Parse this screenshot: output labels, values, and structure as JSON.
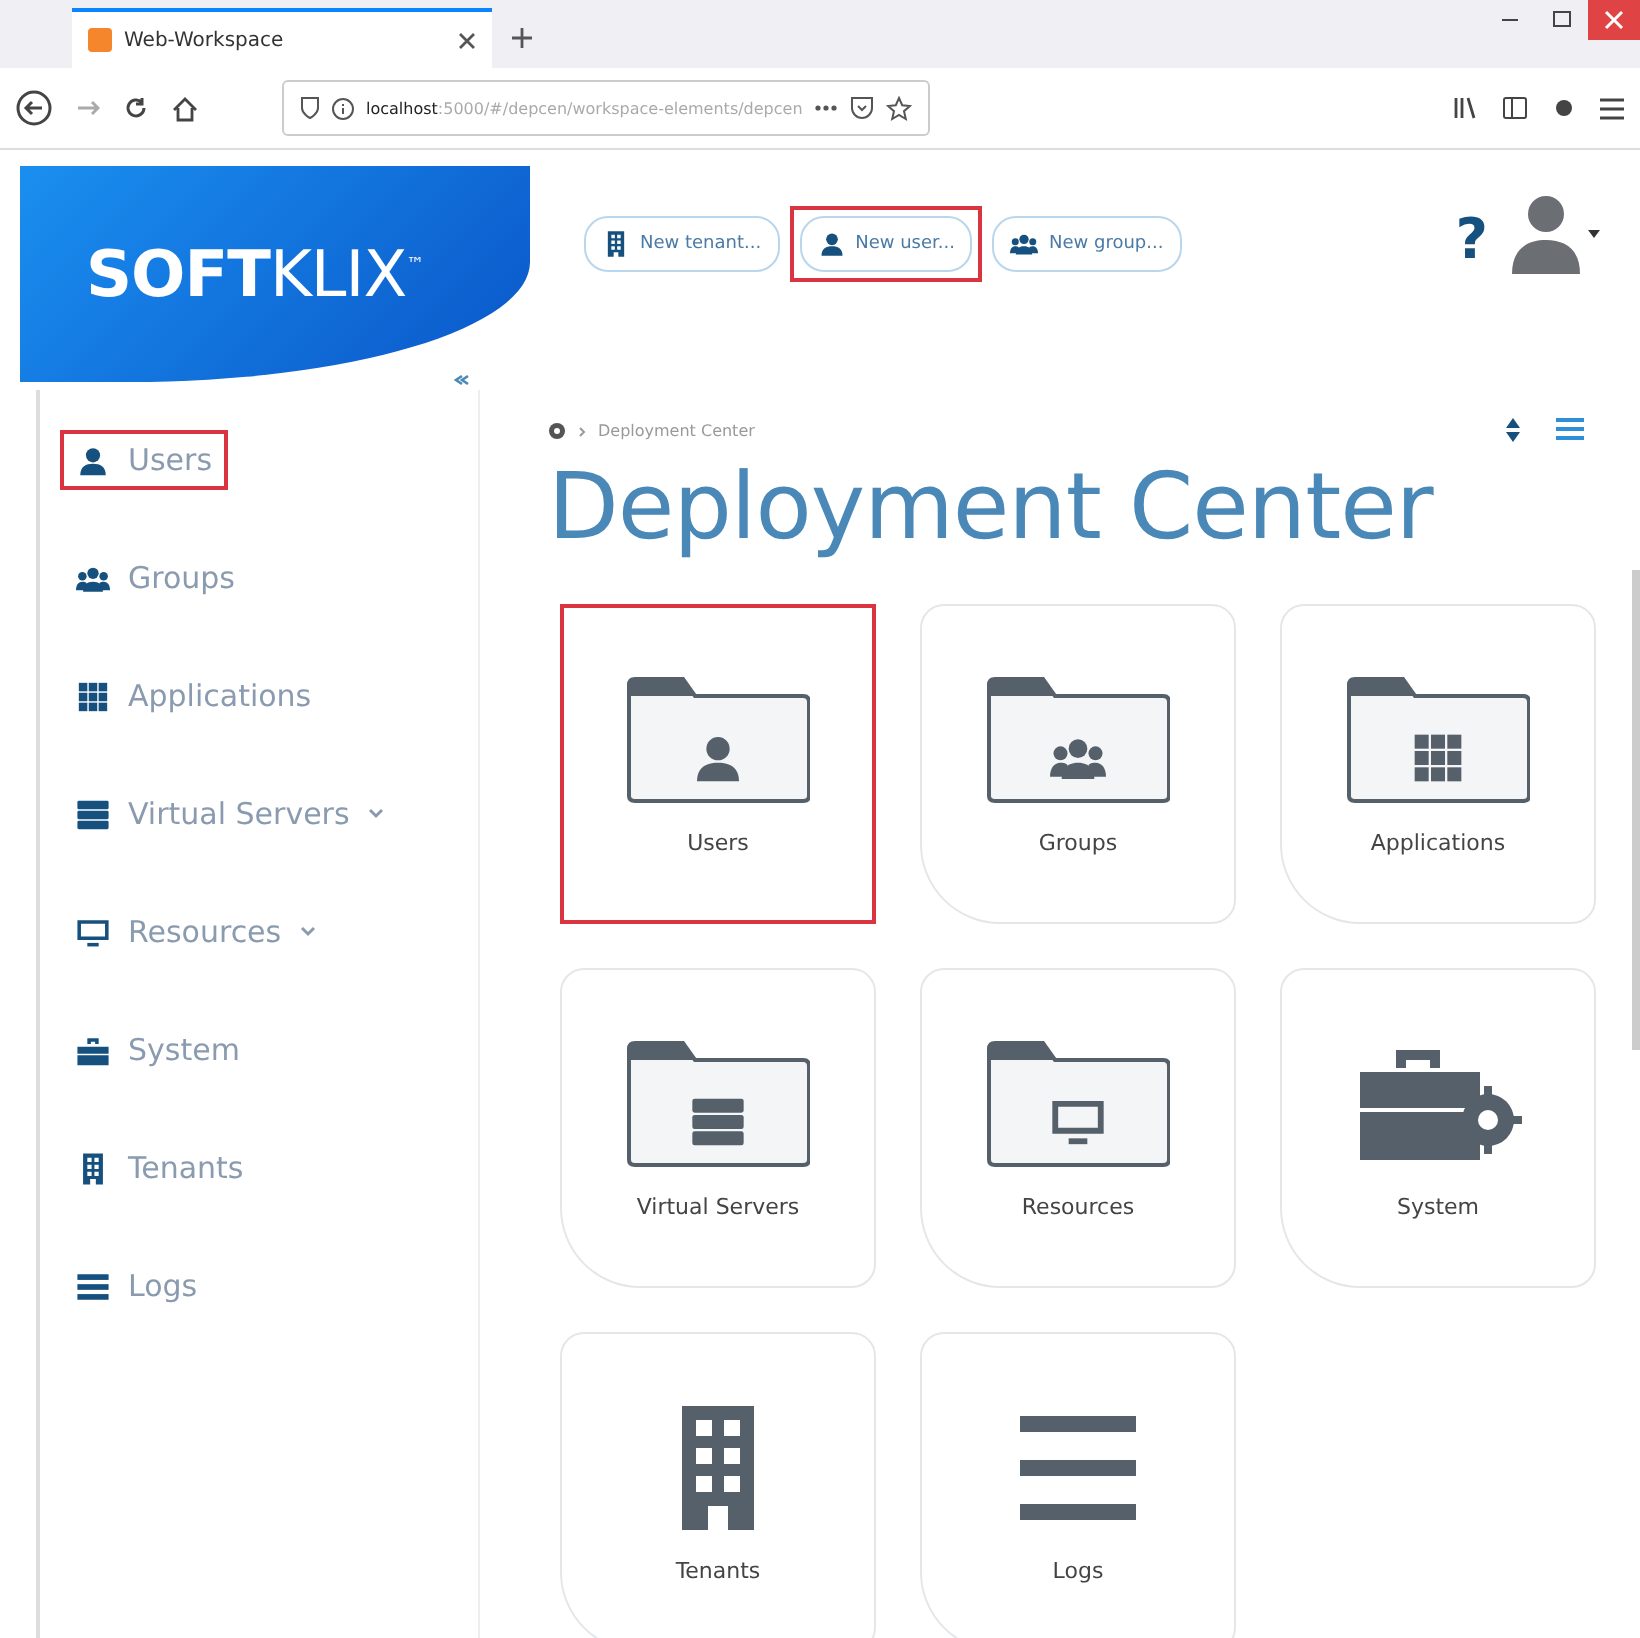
{
  "browser": {
    "tab_title": "Web-Workspace",
    "url_host": "localhost",
    "url_path": ":5000/#/depcen/workspace-elements/depcen"
  },
  "header": {
    "logo_bold": "SOFT",
    "logo_light": "KLIX",
    "logo_mark": "™",
    "help": "?",
    "buttons": [
      {
        "kind": "tenant",
        "label": "New tenant...",
        "highlighted": false
      },
      {
        "kind": "user",
        "label": "New user...",
        "highlighted": true
      },
      {
        "kind": "group",
        "label": "New group...",
        "highlighted": false
      }
    ]
  },
  "sidebar": {
    "items": [
      {
        "kind": "user",
        "label": "Users",
        "highlighted": true,
        "has_submenu": false
      },
      {
        "kind": "group",
        "label": "Groups",
        "highlighted": false,
        "has_submenu": false
      },
      {
        "kind": "apps",
        "label": "Applications",
        "highlighted": false,
        "has_submenu": false
      },
      {
        "kind": "servers",
        "label": "Virtual Servers",
        "highlighted": false,
        "has_submenu": true
      },
      {
        "kind": "monitor",
        "label": "Resources",
        "highlighted": false,
        "has_submenu": true
      },
      {
        "kind": "toolbox",
        "label": "System",
        "highlighted": false,
        "has_submenu": false
      },
      {
        "kind": "tenant",
        "label": "Tenants",
        "highlighted": false,
        "has_submenu": false
      },
      {
        "kind": "list",
        "label": "Logs",
        "highlighted": false,
        "has_submenu": false
      }
    ]
  },
  "breadcrumb": {
    "current": "Deployment Center"
  },
  "title": "Deployment Center",
  "tiles": [
    {
      "kind": "user",
      "label": "Users",
      "highlighted": true
    },
    {
      "kind": "group",
      "label": "Groups",
      "highlighted": false
    },
    {
      "kind": "apps",
      "label": "Applications",
      "highlighted": false
    },
    {
      "kind": "servers",
      "label": "Virtual Servers",
      "highlighted": false
    },
    {
      "kind": "monitor",
      "label": "Resources",
      "highlighted": false
    },
    {
      "kind": "toolbox",
      "label": "System",
      "highlighted": false
    },
    {
      "kind": "tenant",
      "label": "Tenants",
      "highlighted": false
    },
    {
      "kind": "list",
      "label": "Logs",
      "highlighted": false
    }
  ]
}
